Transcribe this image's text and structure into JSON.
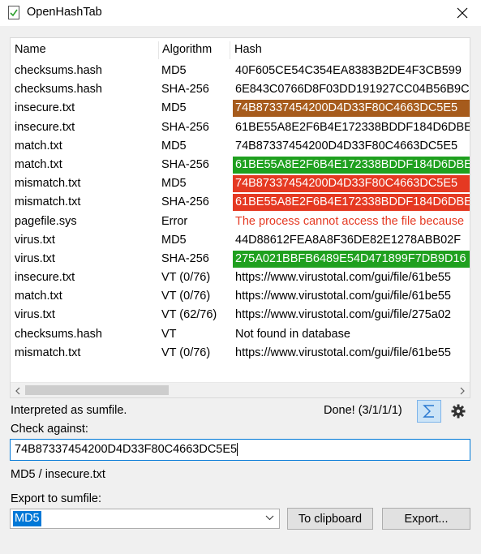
{
  "window": {
    "title": "OpenHashTab"
  },
  "columns": {
    "name": "Name",
    "algorithm": "Algorithm",
    "hash": "Hash"
  },
  "rows": [
    {
      "name": "checksums.hash",
      "alg": "MD5",
      "hash": "40F605CE54C354EA8383B2DE4F3CB599",
      "bg": "",
      "fg": "#000000"
    },
    {
      "name": "checksums.hash",
      "alg": "SHA-256",
      "hash": "6E843C0766D8F03DD191927CC04B56B9C",
      "bg": "",
      "fg": "#000000"
    },
    {
      "name": "insecure.txt",
      "alg": "MD5",
      "hash": "74B87337454200D4D33F80C4663DC5E5",
      "bg": "#a65b1c",
      "fg": "#ffffff"
    },
    {
      "name": "insecure.txt",
      "alg": "SHA-256",
      "hash": "61BE55A8E2F6B4E172338BDDF184D6DBE",
      "bg": "",
      "fg": "#000000"
    },
    {
      "name": "match.txt",
      "alg": "MD5",
      "hash": "74B87337454200D4D33F80C4663DC5E5",
      "bg": "",
      "fg": "#000000"
    },
    {
      "name": "match.txt",
      "alg": "SHA-256",
      "hash": "61BE55A8E2F6B4E172338BDDF184D6DBE",
      "bg": "#1fa01f",
      "fg": "#ffffff"
    },
    {
      "name": "mismatch.txt",
      "alg": "MD5",
      "hash": "74B87337454200D4D33F80C4663DC5E5",
      "bg": "#e53922",
      "fg": "#ffffff"
    },
    {
      "name": "mismatch.txt",
      "alg": "SHA-256",
      "hash": "61BE55A8E2F6B4E172338BDDF184D6DBE",
      "bg": "#e53922",
      "fg": "#ffffff"
    },
    {
      "name": "pagefile.sys",
      "alg": "Error",
      "hash": "The process cannot access the file because",
      "bg": "",
      "fg": "#e53922"
    },
    {
      "name": "virus.txt",
      "alg": "MD5",
      "hash": "44D88612FEA8A8F36DE82E1278ABB02F",
      "bg": "",
      "fg": "#000000"
    },
    {
      "name": "virus.txt",
      "alg": "SHA-256",
      "hash": "275A021BBFB6489E54D471899F7DB9D16",
      "bg": "#1fa01f",
      "fg": "#ffffff"
    },
    {
      "name": "insecure.txt",
      "alg": "VT (0/76)",
      "hash": "https://www.virustotal.com/gui/file/61be55",
      "bg": "",
      "fg": "#000000"
    },
    {
      "name": "match.txt",
      "alg": "VT (0/76)",
      "hash": "https://www.virustotal.com/gui/file/61be55",
      "bg": "",
      "fg": "#000000"
    },
    {
      "name": "virus.txt",
      "alg": "VT (62/76)",
      "hash": "https://www.virustotal.com/gui/file/275a02",
      "bg": "",
      "fg": "#000000"
    },
    {
      "name": "checksums.hash",
      "alg": "VT",
      "hash": "Not found in database",
      "bg": "",
      "fg": "#000000"
    },
    {
      "name": "mismatch.txt",
      "alg": "VT (0/76)",
      "hash": "https://www.virustotal.com/gui/file/61be55",
      "bg": "",
      "fg": "#000000"
    }
  ],
  "scrollbar": {
    "left_icon": "chevron-left-icon",
    "right_icon": "chevron-right-icon"
  },
  "status": {
    "text": "Interpreted as sumfile.",
    "done": "Done! (3/1/1/1)"
  },
  "toolbar": {
    "sum_icon": "sigma-icon",
    "settings_icon": "gear-icon"
  },
  "check": {
    "label": "Check against:",
    "value": "74B87337454200D4D33F80C4663DC5E5",
    "hint": "MD5 / insecure.txt"
  },
  "export": {
    "label": "Export to sumfile:",
    "selected": "MD5",
    "clipboard_label": "To clipboard",
    "export_label": "Export..."
  },
  "colors": {
    "accent": "#0078d7",
    "match": "#1fa01f",
    "mismatch": "#e53922",
    "insecure": "#a65b1c"
  }
}
